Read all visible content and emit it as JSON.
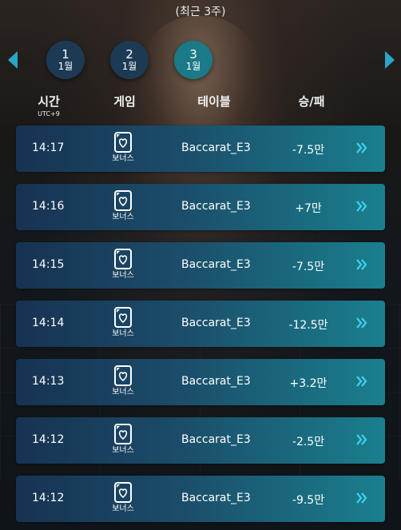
{
  "range_label": "(최근 3주)",
  "months": [
    {
      "num": "1",
      "unit": "1월",
      "active": false
    },
    {
      "num": "2",
      "unit": "1월",
      "active": false
    },
    {
      "num": "3",
      "unit": "1월",
      "active": true
    }
  ],
  "headers": {
    "time": "시간",
    "timezone": "UTC+9",
    "game": "게임",
    "table": "테이블",
    "result": "승/패"
  },
  "rows": [
    {
      "time": "14:17",
      "game": "보너스",
      "table": "Baccarat_E3",
      "result": "-7.5만"
    },
    {
      "time": "14:16",
      "game": "보너스",
      "table": "Baccarat_E3",
      "result": "+7만"
    },
    {
      "time": "14:15",
      "game": "보너스",
      "table": "Baccarat_E3",
      "result": "-7.5만"
    },
    {
      "time": "14:14",
      "game": "보너스",
      "table": "Baccarat_E3",
      "result": "-12.5만"
    },
    {
      "time": "14:13",
      "game": "보너스",
      "table": "Baccarat_E3",
      "result": "+3.2만"
    },
    {
      "time": "14:12",
      "game": "보너스",
      "table": "Baccarat_E3",
      "result": "-2.5만"
    },
    {
      "time": "14:12",
      "game": "보너스",
      "table": "Baccarat_E3",
      "result": "-9.5만"
    }
  ],
  "colors": {
    "accent": "#29a7c9",
    "active_tab": "#1a7a88",
    "tab": "#1d3a55"
  },
  "icons": {
    "prev": "triangle-left-icon",
    "next": "triangle-right-icon",
    "game": "playing-card-heart-icon",
    "row_action": "double-chevron-right-icon"
  }
}
